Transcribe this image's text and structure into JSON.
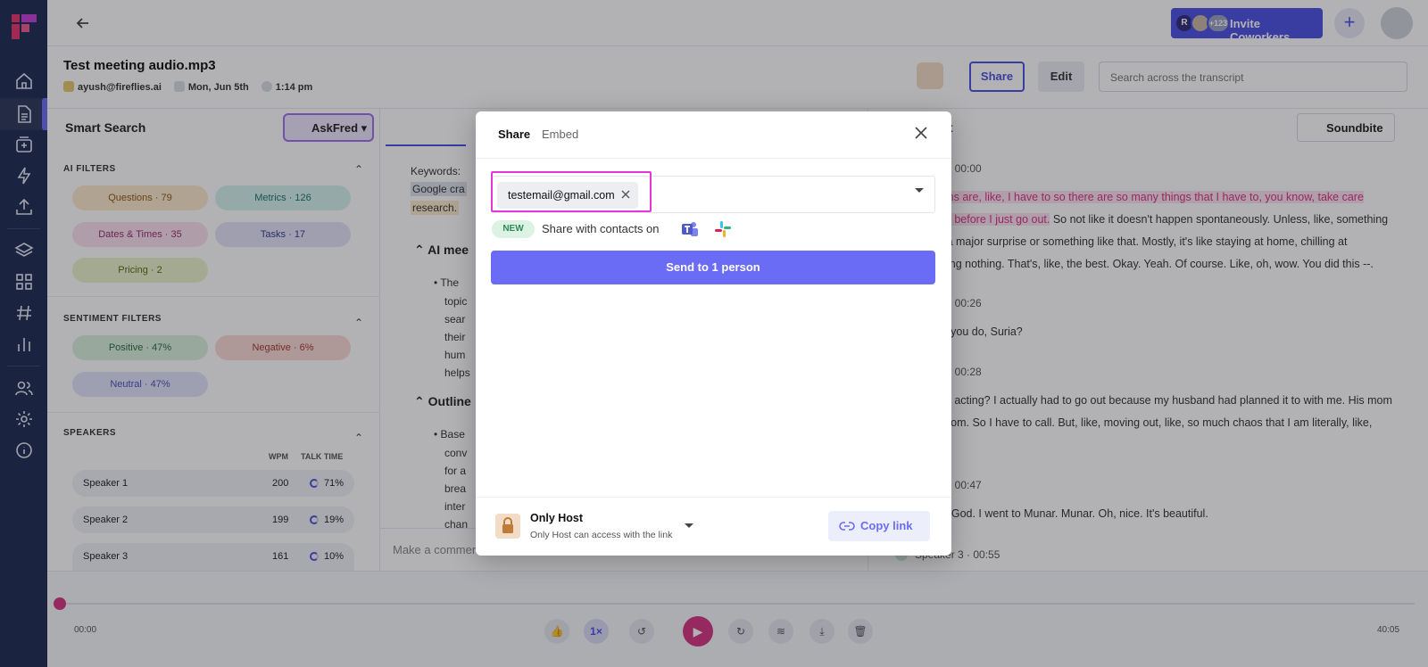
{
  "topbar": {
    "invite_label": "Invite Coworkers",
    "avatar_initial": "R",
    "avatar_count": "+123"
  },
  "meeting": {
    "title": "Test meeting audio.mp3",
    "owner": "ayush@fireflies.ai",
    "date": "Mon, Jun 5th",
    "time": "1:14 pm",
    "share_label": "Share",
    "edit_label": "Edit",
    "search_placeholder": "Search across the transcript"
  },
  "left_panel": {
    "title": "Smart Search",
    "askfred_label": "AskFred",
    "ai_filters_heading": "AI FILTERS",
    "ai_filters": [
      {
        "label": "Questions · 79",
        "bg": "#fde9c9",
        "fg": "#8a5a12"
      },
      {
        "label": "Metrics · 126",
        "bg": "#d6f2ee",
        "fg": "#1f6f66"
      },
      {
        "label": "Dates & Times · 35",
        "bg": "#fbe0ef",
        "fg": "#9b2c68"
      },
      {
        "label": "Tasks · 17",
        "bg": "#e3e3f7",
        "fg": "#3b3b8a"
      },
      {
        "label": "Pricing · 2",
        "bg": "#eaf3c9",
        "fg": "#5a6b12"
      }
    ],
    "sentiment_heading": "SENTIMENT FILTERS",
    "sentiment_filters": [
      {
        "label": "Positive · 47%",
        "bg": "#d9f0dc",
        "fg": "#2e6b39"
      },
      {
        "label": "Negative · 6%",
        "bg": "#fbd9d4",
        "fg": "#a23a2a"
      },
      {
        "label": "Neutral · 47%",
        "bg": "#e3e3fb",
        "fg": "#4b4fc0"
      }
    ],
    "speakers_heading": "SPEAKERS",
    "wpm_header": "WPM",
    "talk_header": "TALK TIME",
    "speakers": [
      {
        "name": "Speaker 1",
        "wpm": "200",
        "talk": "71%"
      },
      {
        "name": "Speaker 2",
        "wpm": "199",
        "talk": "19%"
      },
      {
        "name": "Speaker 3",
        "wpm": "161",
        "talk": "10%"
      }
    ]
  },
  "center_panel": {
    "keywords_label": "Keywords:",
    "keyword_1": "Google cra",
    "keyword_2": "research.",
    "ai_heading": "AI mee",
    "ai_lines": [
      "The",
      "topic",
      "sear",
      "their",
      "hum",
      "helps"
    ],
    "outline_heading": "Outline",
    "outline_lines": [
      "Base",
      "conv",
      "for a",
      "brea",
      "inter",
      "chan"
    ],
    "comment_placeholder": "Make a comment"
  },
  "right_panel": {
    "title": "ript",
    "soundbite_label": "Soundbite",
    "entries": [
      {
        "meta": "r 1  ·  00:00"
      },
      {
        "meta": "r 2  ·  00:26"
      },
      {
        "meta": "r 3  ·  00:28"
      },
      {
        "meta": "r 1  ·  00:47"
      }
    ],
    "line_1a": "plans are, like, I have to so there are so many things that I have to, you know, take care",
    "line_1b_hl": "and before I just go out.",
    "line_1b": " So not like it doesn't happen spontaneously. Unless, like, something",
    "line_1c": "t's a major surprise or something like that. Mostly, it's like staying at home, chilling at",
    "line_1d": "Doing nothing. That's, like, the best. Okay. Yeah. Of course. Like, oh, wow. You did this --.",
    "line_2": "did you do, Suria?",
    "line_3a": "ong acting? I actually had to go out because my husband had planned it to with me. His mom",
    "line_3b": "y mom. So I have to call. But, like, moving out, like, so much chaos that I am literally, like,",
    "line_4": "ah. God. I went to Munar. Munar. Oh, nice. It's beautiful.",
    "speaker_last": "Speaker 3  ·  00:55"
  },
  "player": {
    "start_time": "00:00",
    "end_time": "40:05",
    "speed": "1×"
  },
  "modal": {
    "tab_share": "Share",
    "tab_embed": "Embed",
    "email_chip": "testemail@gmail.com",
    "new_badge": "NEW",
    "share_with": "Share with contacts on",
    "send_label": "Send to 1 person",
    "access_title": "Only Host",
    "access_subtitle": "Only Host can access with the link",
    "copy_link": "Copy link"
  }
}
